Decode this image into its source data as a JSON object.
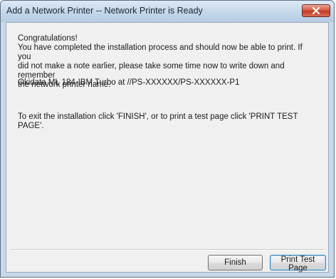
{
  "window": {
    "title": "Add a Network Printer -- Network Printer is Ready"
  },
  "icons": {
    "close": "close-icon"
  },
  "content": {
    "message_lines": [
      "Congratulations!",
      "You have completed the installation process and should now be able to print. If you",
      "did not make a note earlier, please take some time now to write down and remember",
      "the network printer name."
    ],
    "printer_line": "Okidata ML 184-IBM Turbo at //PS-XXXXXX/PS-XXXXXX-P1",
    "exit_lines": [
      "To exit the installation click 'FINISH', or to print a test page click 'PRINT TEST",
      "PAGE'."
    ]
  },
  "buttons": {
    "finish": "Finish",
    "print_test_page": "Print Test Page"
  }
}
